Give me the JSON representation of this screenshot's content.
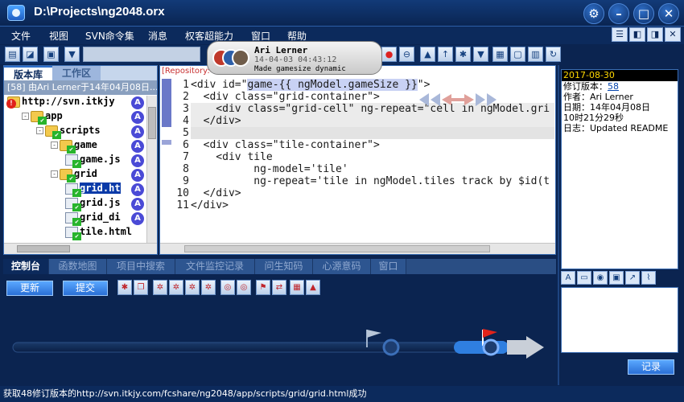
{
  "window": {
    "title": "D:\\Projects\\ng2048.orx"
  },
  "menu": [
    "文件",
    "视图",
    "SVN命令集",
    "消息",
    "权客超能力",
    "窗口",
    "帮助"
  ],
  "tooltip": {
    "name": "Ari Lerner",
    "date": "14-04-03 04:43:12",
    "message": "Made gamesize dynamic"
  },
  "left_panel": {
    "tabs": [
      "版本库",
      "工作区"
    ],
    "revision_header": "[58] 由Ari Lerner于14年04月08日...",
    "tree": [
      {
        "label": "http://svn.itkjy",
        "indent": 0,
        "type": "folder",
        "toggle": "",
        "status": "error",
        "author": "A"
      },
      {
        "label": "app",
        "indent": 1,
        "type": "folder",
        "toggle": "-",
        "status": "ok",
        "author": "A"
      },
      {
        "label": "scripts",
        "indent": 2,
        "type": "folder",
        "toggle": "-",
        "status": "ok",
        "author": "A"
      },
      {
        "label": "game",
        "indent": 3,
        "type": "folder",
        "toggle": "-",
        "status": "ok",
        "author": "A"
      },
      {
        "label": "game.js",
        "indent": 4,
        "type": "file",
        "toggle": "",
        "status": "ok",
        "author": "A"
      },
      {
        "label": "grid",
        "indent": 3,
        "type": "folder",
        "toggle": "-",
        "status": "ok",
        "author": "A"
      },
      {
        "label": "grid.ht",
        "indent": 4,
        "type": "file",
        "toggle": "",
        "status": "ok",
        "author": "A",
        "selected": true
      },
      {
        "label": "grid.js",
        "indent": 4,
        "type": "file",
        "toggle": "",
        "status": "ok",
        "author": "A"
      },
      {
        "label": "grid_di",
        "indent": 4,
        "type": "file",
        "toggle": "",
        "status": "ok",
        "author": "A"
      },
      {
        "label": "tile.html",
        "indent": 4,
        "type": "file",
        "toggle": "",
        "status": "ok",
        "author": ""
      }
    ]
  },
  "editor": {
    "header": "[Repository:48]app\\s",
    "lines": [
      "<div id=\"game-{{ ngModel.gameSize }}\">",
      "  <div class=\"grid-container\">",
      "    <div class=\"grid-cell\" ng-repeat=\"cell in ngModel.gri",
      "  </div>",
      "",
      "  <div class=\"tile-container\">",
      "    <div tile",
      "          ng-model='tile'",
      "          ng-repeat='tile in ngModel.tiles track by $id(t",
      "  </div>",
      "</div>"
    ],
    "line_numbers": [
      "1",
      "2",
      "3",
      "4",
      "5",
      "6",
      "7",
      "8",
      "9",
      "10",
      "11"
    ],
    "selection_text": "game-{{ ngModel.gameSize }}"
  },
  "info": {
    "date": "2017-08-30",
    "revision_label": "修订版本：",
    "revision": "58",
    "author_line": "作者：Ari Lerner",
    "date_line": "日期：14年04月08日",
    "time_line": "10时21分29秒",
    "log_line": "日志：Updated README"
  },
  "bottom": {
    "tabs": [
      "控制台",
      "函数地图",
      "项目中搜索",
      "文件监控记录",
      "问生知码",
      "心源意码",
      "窗口"
    ],
    "update_label": "更新",
    "commit_label": "提交",
    "record_label": "记录"
  },
  "status": "获取48修订版本的http://svn.itkjy.com/fcshare/ng2048/app/scripts/grid/grid.html成功",
  "colors": {
    "background": "#0b2450",
    "accent": "#2a6fd6",
    "selection": "#0a3aa8",
    "status_ok": "#27b42c",
    "status_error": "#e0201a"
  }
}
